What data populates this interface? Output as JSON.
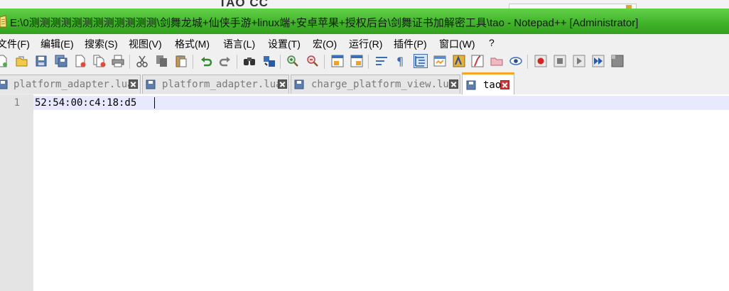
{
  "background": {
    "partial_text": "TAO CC"
  },
  "window": {
    "title": "E:\\0测测测测测测测测测测测测\\剑舞龙城+仙侠手游+linux端+安卓苹果+授权后台\\剑舞证书加解密工具\\tao - Notepad++ [Administrator]"
  },
  "menu": [
    {
      "label": "文件(F)"
    },
    {
      "label": "编辑(E)"
    },
    {
      "label": "搜索(S)"
    },
    {
      "label": "视图(V)"
    },
    {
      "label": "格式(M)"
    },
    {
      "label": "语言(L)"
    },
    {
      "label": "设置(T)"
    },
    {
      "label": "宏(O)"
    },
    {
      "label": "运行(R)"
    },
    {
      "label": "插件(P)"
    },
    {
      "label": "窗口(W)"
    },
    {
      "label": "?"
    }
  ],
  "toolbar": {
    "icons": [
      "new-file-icon",
      "open-file-icon",
      "save-icon",
      "save-all-icon",
      "close-icon",
      "close-all-icon",
      "print-icon",
      "cut-icon",
      "copy-icon",
      "paste-icon",
      "undo-icon",
      "redo-icon",
      "find-icon",
      "replace-icon",
      "zoom-in-icon",
      "zoom-out-icon",
      "sync-vertical-icon",
      "sync-horizontal-icon",
      "word-wrap-icon",
      "show-all-characters-icon",
      "indent-guide-icon",
      "user-defined-language-icon",
      "document-map-icon",
      "function-list-icon",
      "folder-workspace-icon",
      "monitoring-icon",
      "record-macro-icon",
      "stop-recording-icon",
      "playback-macro-icon",
      "run-macro-multiple-icon",
      "save-macro-icon"
    ]
  },
  "tabs": [
    {
      "label": "platform_adapter.lua",
      "active": false
    },
    {
      "label": "platform_adapter.lua",
      "active": false
    },
    {
      "label": "charge_platform_view.lua",
      "active": false
    },
    {
      "label": "tao",
      "active": true
    }
  ],
  "editor": {
    "lines": [
      {
        "number": "1",
        "text": "52:54:00:c4:18:d5"
      }
    ]
  },
  "colors": {
    "titlebar": "#41b42a",
    "active_tab_accent": "#f6a623",
    "current_line": "#e8e8ff"
  }
}
